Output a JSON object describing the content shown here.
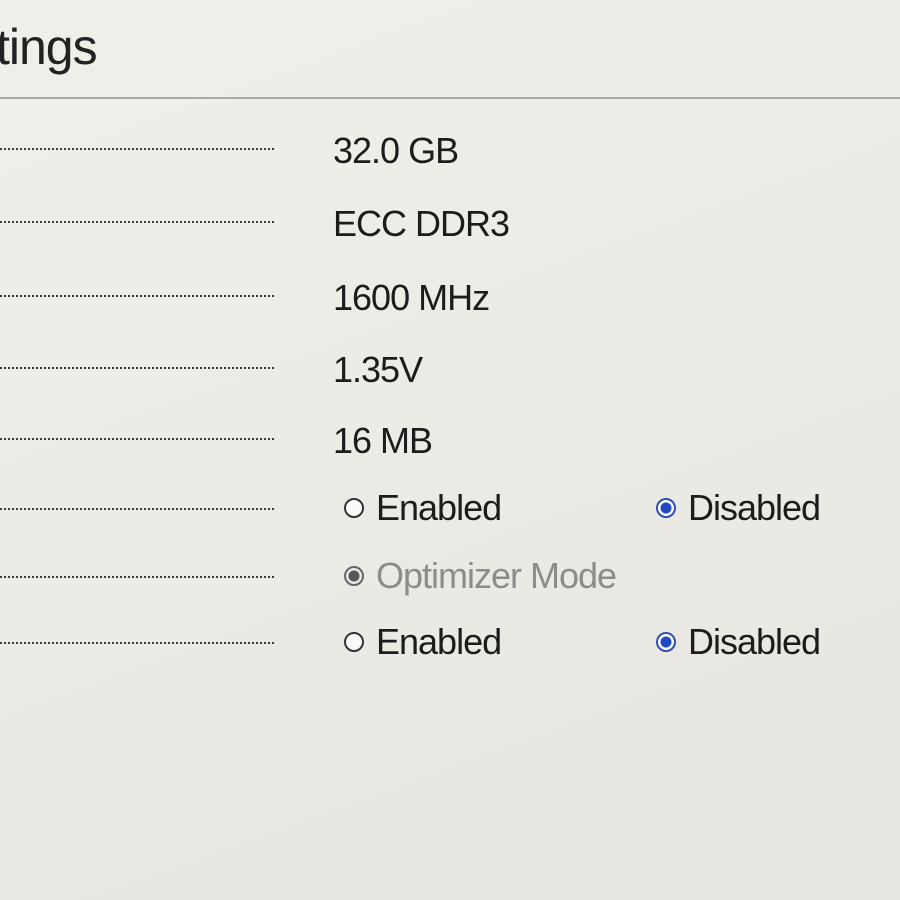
{
  "header": {
    "title": "tings"
  },
  "memory": {
    "size": "32.0 GB",
    "type": "ECC DDR3",
    "speed": "1600 MHz",
    "voltage": "1.35V",
    "cache": "16 MB"
  },
  "options": [
    {
      "choices": [
        {
          "label": "Enabled",
          "selected": false
        },
        {
          "label": "Disabled",
          "selected": true
        }
      ]
    },
    {
      "choices": [
        {
          "label": "Optimizer Mode",
          "selected": true,
          "greyed": true
        }
      ]
    },
    {
      "choices": [
        {
          "label": "Enabled",
          "selected": false
        },
        {
          "label": "Disabled",
          "selected": true
        }
      ]
    }
  ],
  "colors": {
    "radio_selected": "#1f47c2",
    "greyed_text": "#8c8c8c",
    "background": "#ecebe6"
  }
}
